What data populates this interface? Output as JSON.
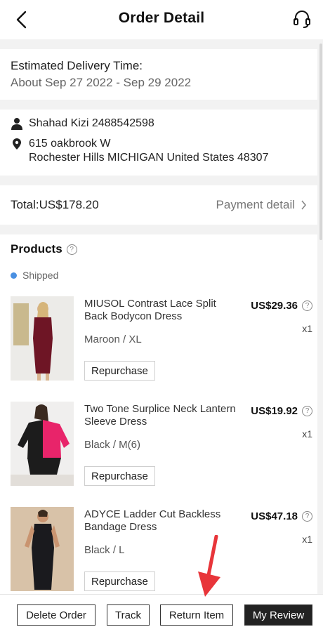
{
  "header": {
    "title": "Order Detail",
    "back_icon": "chevron-left-icon",
    "support_icon": "headset-icon"
  },
  "delivery": {
    "label": "Estimated Delivery Time:",
    "date_range": "About Sep 27 2022 - Sep 29 2022"
  },
  "address": {
    "name_phone": "Shahad Kizi 2488542598",
    "line1": "615 oakbrook W",
    "line2": "Rochester Hills MICHIGAN United States 48307"
  },
  "total": {
    "label": "Total:US$178.20",
    "payment_detail": "Payment detail"
  },
  "products": {
    "heading": "Products",
    "status": "Shipped",
    "items": [
      {
        "name": "MIUSOL Contrast Lace Split Back Bodycon Dress",
        "variant": "Maroon / XL",
        "price": "US$29.36",
        "qty": "x1",
        "action": "Repurchase"
      },
      {
        "name": "Two Tone Surplice Neck Lantern Sleeve Dress",
        "variant": "Black / M(6)",
        "price": "US$19.92",
        "qty": "x1",
        "action": "Repurchase"
      },
      {
        "name": "ADYCE Ladder Cut Backless Bandage Dress",
        "variant": "Black / L",
        "price": "US$47.18",
        "qty": "x1",
        "action": "Repurchase"
      }
    ]
  },
  "footer": {
    "delete": "Delete Order",
    "track": "Track",
    "return": "Return Item",
    "review": "My Review"
  },
  "colors": {
    "accent_red": "#e8353a",
    "status_blue": "#4a90e2",
    "dark_button": "#222222"
  }
}
